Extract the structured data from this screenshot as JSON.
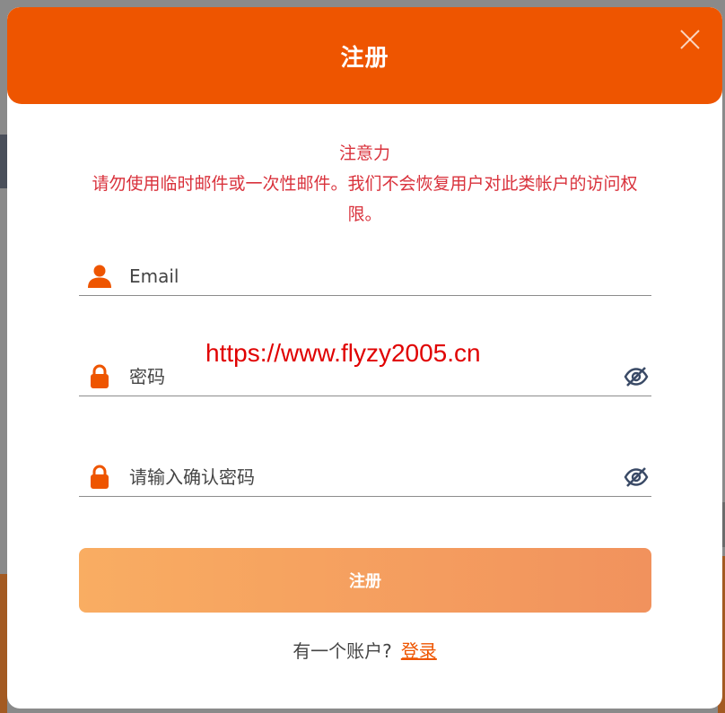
{
  "modal": {
    "title": "注册",
    "close_label": "×"
  },
  "notice": {
    "heading": "注意力",
    "body": "请勿使用临时邮件或一次性邮件。我们不会恢复用户对此类帐户的访问权限。"
  },
  "form": {
    "email_placeholder": "Email",
    "password_placeholder": "密码",
    "confirm_placeholder": "请输入确认密码",
    "submit_label": "注册"
  },
  "footer": {
    "prompt": "有一个账户?",
    "login_label": "登录"
  },
  "watermark": "https://www.flyzy2005.cn",
  "colors": {
    "brand": "#ee5500",
    "notice": "#d9323c",
    "button_start": "#f9ad62",
    "button_end": "#f1925d"
  }
}
